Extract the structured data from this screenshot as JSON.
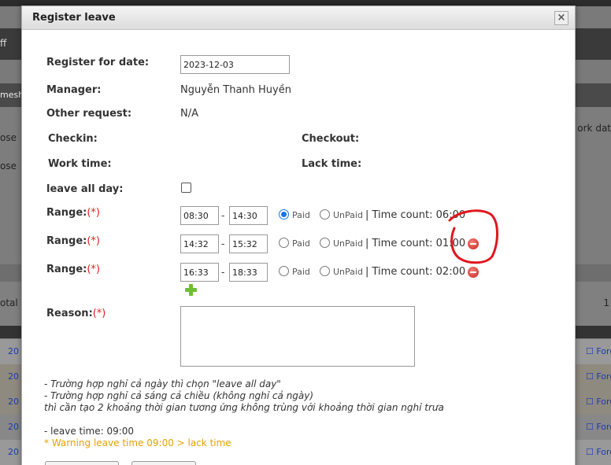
{
  "background": {
    "nav_left": "ff",
    "band_left": "mesh",
    "panel_left_1": "ose",
    "panel_left_2": "ose",
    "panel_right": "ork dat",
    "total_left": "otal",
    "total_right": "1",
    "rows": [
      {
        "left": "20",
        "right": "☐ Forg"
      },
      {
        "left": "20",
        "right": "☐ Forg"
      },
      {
        "left": "20",
        "right": "☐ Forg"
      },
      {
        "left": "20",
        "right": "☐ Forg"
      },
      {
        "left": "20",
        "right": "☐ Forg"
      }
    ]
  },
  "modal": {
    "title": "Register leave",
    "close_symbol": "×",
    "register_for_date_label": "Register for date:",
    "register_for_date_value": "2023-12-03",
    "manager_label": "Manager:",
    "manager_value": "Nguyễn Thanh Huyền",
    "other_request_label": "Other request:",
    "other_request_value": "N/A",
    "checkin_label": "Checkin:",
    "checkout_label": "Checkout:",
    "work_time_label": "Work time:",
    "lack_time_label": "Lack time:",
    "leave_all_day_label": "leave all day:",
    "range_label": "Range:",
    "required_mark": "(*)",
    "paid_label": "Paid",
    "unpaid_label": "UnPaid",
    "ranges": [
      {
        "from": "08:30",
        "to": "14:30",
        "paid": true,
        "time_count": "| Time count: 06:00"
      },
      {
        "from": "14:32",
        "to": "15:32",
        "paid": false,
        "time_count": "| Time count: 01:00"
      },
      {
        "from": "16:33",
        "to": "18:33",
        "paid": false,
        "time_count": "| Time count: 02:00"
      }
    ],
    "reason_label": "Reason:",
    "notes": [
      "- Trường hợp nghỉ cả ngày thì chọn \"leave all day\"",
      "- Trường hợp nghỉ cả sáng cả chiều (không nghỉ cả ngày)",
      "thì cần tạo 2 khoảng thời gian tương ứng không trùng với khoảng thời gian nghỉ trưa"
    ],
    "leave_time": "- leave time: 09:00",
    "warning": "* Warning leave time 09:00 > lack time"
  },
  "colors": {
    "required": "#e02020",
    "warning": "#e8a000",
    "annotation": "#e0161e",
    "link": "#1a3ab0"
  }
}
